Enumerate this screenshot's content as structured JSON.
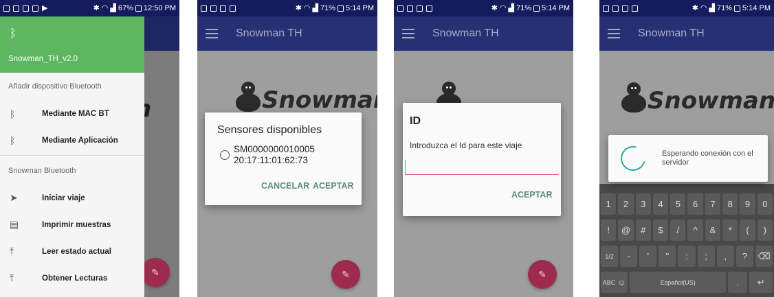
{
  "screen1": {
    "status": {
      "battery": "67%",
      "time": "12:50 PM"
    },
    "drawer": {
      "bt_icon": "bluetooth-icon",
      "device_name": "Snowman_TH_v2.0",
      "section_add": "Añadir dispositivo Bluetooth",
      "add_items": [
        {
          "icon": "bluetooth-icon",
          "label": "Mediante MAC BT"
        },
        {
          "icon": "bluetooth-icon",
          "label": "Mediante Aplicación"
        }
      ],
      "section_snowman": "Snowman Bluetooth",
      "snowman_items": [
        {
          "icon": "send-icon",
          "label": "Iniciar viaje"
        },
        {
          "icon": "print-icon",
          "label": "Imprimir muestras"
        },
        {
          "icon": "upload-icon",
          "label": "Leer estado actual"
        },
        {
          "icon": "upload-icon",
          "label": "Obtener Lecturas"
        }
      ]
    }
  },
  "screen2": {
    "status": {
      "battery": "71%",
      "time": "5:14 PM"
    },
    "app_title": "Snowman TH",
    "logo_text": "Snowman",
    "dialog": {
      "title": "Sensores disponibles",
      "sensor_id": "SM0000000010005",
      "sensor_mac": "20:17:11:01:62:73",
      "cancel": "CANCELAR",
      "accept": "ACEPTAR"
    }
  },
  "screen3": {
    "status": {
      "battery": "71%",
      "time": "5:14 PM"
    },
    "app_title": "Snowman TH",
    "dialog": {
      "title": "ID",
      "message": "Introduzca el Id para este viaje",
      "input_value": "",
      "accept": "ACEPTAR"
    }
  },
  "screen4": {
    "status": {
      "battery": "71%",
      "time": "5:14 PM"
    },
    "app_title": "Snowman TH",
    "logo_text": "Snowman",
    "progress": {
      "message": "Esperando conexión con el servidor"
    },
    "keyboard": {
      "row1": [
        "1",
        "2",
        "3",
        "4",
        "5",
        "6",
        "7",
        "8",
        "9",
        "0"
      ],
      "row2": [
        "!",
        "@",
        "#",
        "$",
        "/",
        "^",
        "&",
        "*",
        "(",
        ")"
      ],
      "row3": [
        "1/2",
        "-",
        "'",
        "\"",
        ":",
        ";",
        ",",
        "?",
        "⌫"
      ],
      "abc": "ABC",
      "space_label": "Español(US)",
      "dot": ".",
      "enter": "↵"
    }
  },
  "colors": {
    "appbar": "#263073",
    "drawer_header": "#5cb760",
    "fab": "#9c2b4f",
    "accent_text": "#5b8f74",
    "input_line": "#e05a7e",
    "spinner": "#2aa4a0"
  }
}
